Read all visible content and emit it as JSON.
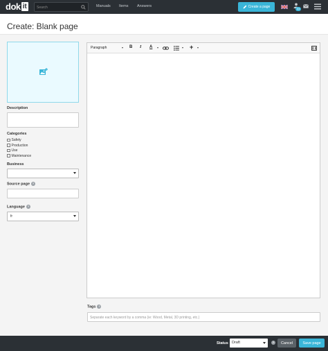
{
  "nav": {
    "logo_text": "dok",
    "logo_box": "it",
    "search_placeholder": "Search",
    "links": [
      "Manuals",
      "Items",
      "Answers"
    ],
    "create_button": "Create a page",
    "notification_count": "33",
    "accent_color": "#3ab5d8"
  },
  "page": {
    "title": "Create: Blank page"
  },
  "left": {
    "description_label": "Description",
    "categories_label": "Categories",
    "categories": [
      "Safety",
      "Production",
      "Use",
      "Maintenance"
    ],
    "business_label": "Business",
    "business_value": "",
    "source_page_label": "Source page",
    "language_label": "Language",
    "language_value": "fr"
  },
  "editor": {
    "paragraph_select": "Paragraph"
  },
  "tags": {
    "label": "Tags",
    "placeholder": "Separate each keyword by a comma (ie: Wood, Metal, 3D printing, etc.)"
  },
  "footer": {
    "status_label": "Status",
    "status_value": "Draft",
    "cancel_label": "Cancel",
    "save_label": "Save page"
  }
}
